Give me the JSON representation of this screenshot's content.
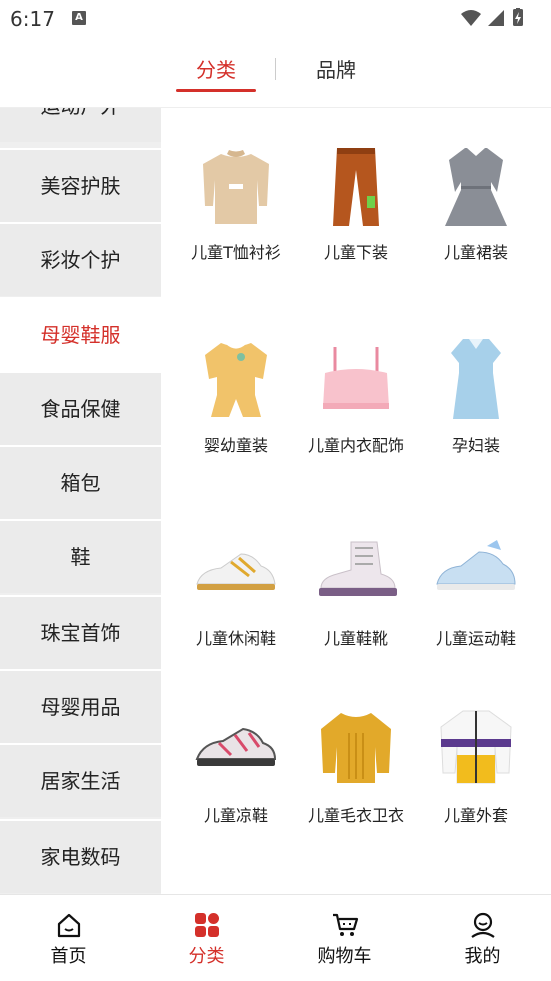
{
  "status_bar": {
    "time": "6:17",
    "notif_icon": "A"
  },
  "top_tabs": [
    {
      "label": "分类",
      "active": true
    },
    {
      "label": "品牌",
      "active": false
    }
  ],
  "sidebar": {
    "items": [
      {
        "label": "运动户外"
      },
      {
        "label": "美容护肤"
      },
      {
        "label": "彩妆个护"
      },
      {
        "label": "母婴鞋服",
        "active": true
      },
      {
        "label": "食品保健"
      },
      {
        "label": "箱包"
      },
      {
        "label": "鞋"
      },
      {
        "label": "珠宝首饰"
      },
      {
        "label": "母婴用品"
      },
      {
        "label": "居家生活"
      },
      {
        "label": "家电数码"
      }
    ]
  },
  "grid": {
    "items": [
      {
        "label": "儿童T恤衬衫",
        "icon": "kids-tshirt-icon"
      },
      {
        "label": "儿童下装",
        "icon": "kids-pants-icon"
      },
      {
        "label": "儿童裙装",
        "icon": "kids-dress-icon"
      },
      {
        "label": "婴幼童装",
        "icon": "baby-romper-icon"
      },
      {
        "label": "儿童内衣配饰",
        "icon": "kids-underwear-icon"
      },
      {
        "label": "孕妇装",
        "icon": "maternity-dress-icon"
      },
      {
        "label": "儿童休闲鞋",
        "icon": "kids-casual-shoe-icon"
      },
      {
        "label": "儿童鞋靴",
        "icon": "kids-boot-icon"
      },
      {
        "label": "儿童运动鞋",
        "icon": "kids-sneaker-icon"
      },
      {
        "label": "儿童凉鞋",
        "icon": "kids-sandal-icon"
      },
      {
        "label": "儿童毛衣卫衣",
        "icon": "kids-sweater-icon"
      },
      {
        "label": "儿童外套",
        "icon": "kids-jacket-icon"
      }
    ]
  },
  "bottom_nav": [
    {
      "label": "首页",
      "icon": "home-icon"
    },
    {
      "label": "分类",
      "icon": "category-icon",
      "active": true
    },
    {
      "label": "购物车",
      "icon": "cart-icon"
    },
    {
      "label": "我的",
      "icon": "profile-icon"
    }
  ],
  "colors": {
    "accent": "#d4302a",
    "sidebar_bg": "#ebebeb"
  }
}
